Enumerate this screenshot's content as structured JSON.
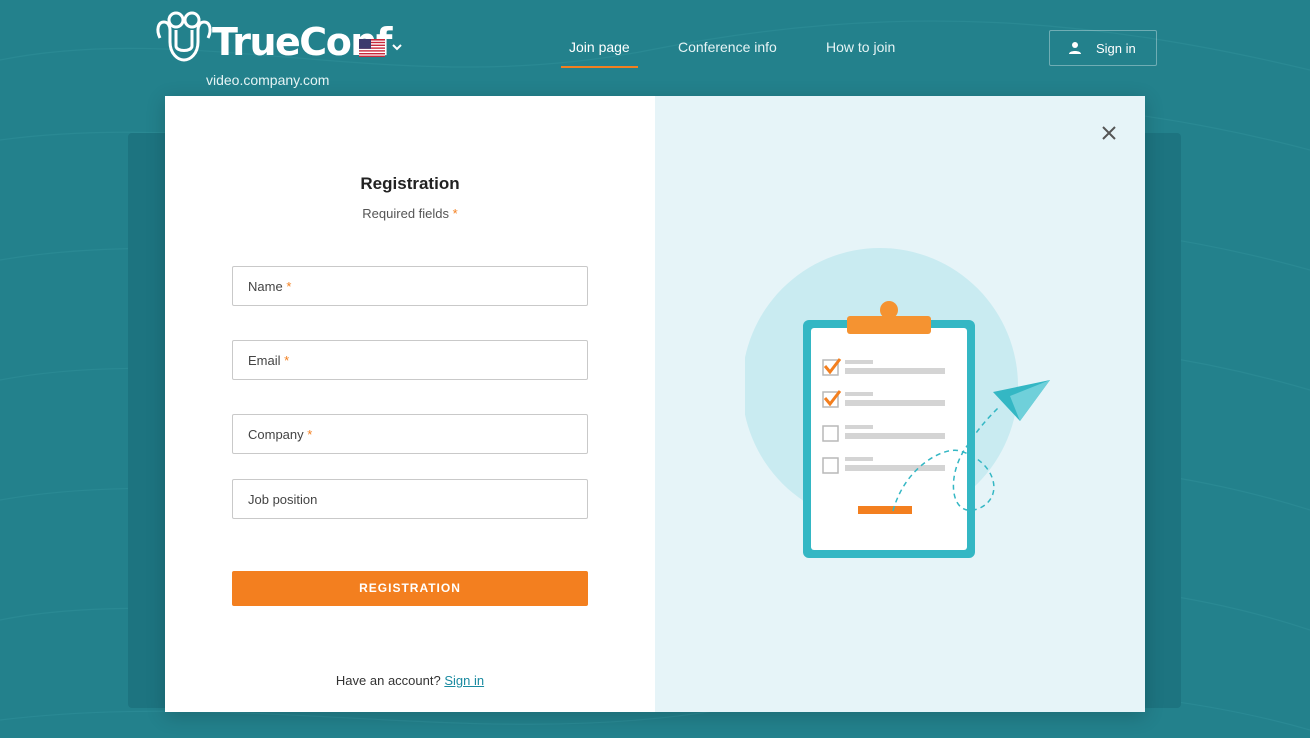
{
  "header": {
    "logo_text": "TrueConf",
    "server_domain": "video.company.com",
    "language": "English (US)"
  },
  "nav": {
    "tabs": [
      {
        "label": "Join page",
        "active": true
      },
      {
        "label": "Conference info",
        "active": false
      },
      {
        "label": "How to join",
        "active": false
      }
    ],
    "signin_label": "Sign in"
  },
  "modal": {
    "title": "Registration",
    "required_hint": "Required fields",
    "required_marker": "*",
    "fields": [
      {
        "label": "Name",
        "required": true
      },
      {
        "label": "Email",
        "required": true
      },
      {
        "label": "Company",
        "required": true
      },
      {
        "label": "Job position",
        "required": false
      }
    ],
    "submit_label": "REGISTRATION",
    "account_prompt": "Have an account?",
    "signin_link": "Sign in"
  },
  "colors": {
    "background": "#23818c",
    "accent": "#f37f1f",
    "link": "#1a8aa0",
    "illustration_bg": "#e6f4f8"
  }
}
